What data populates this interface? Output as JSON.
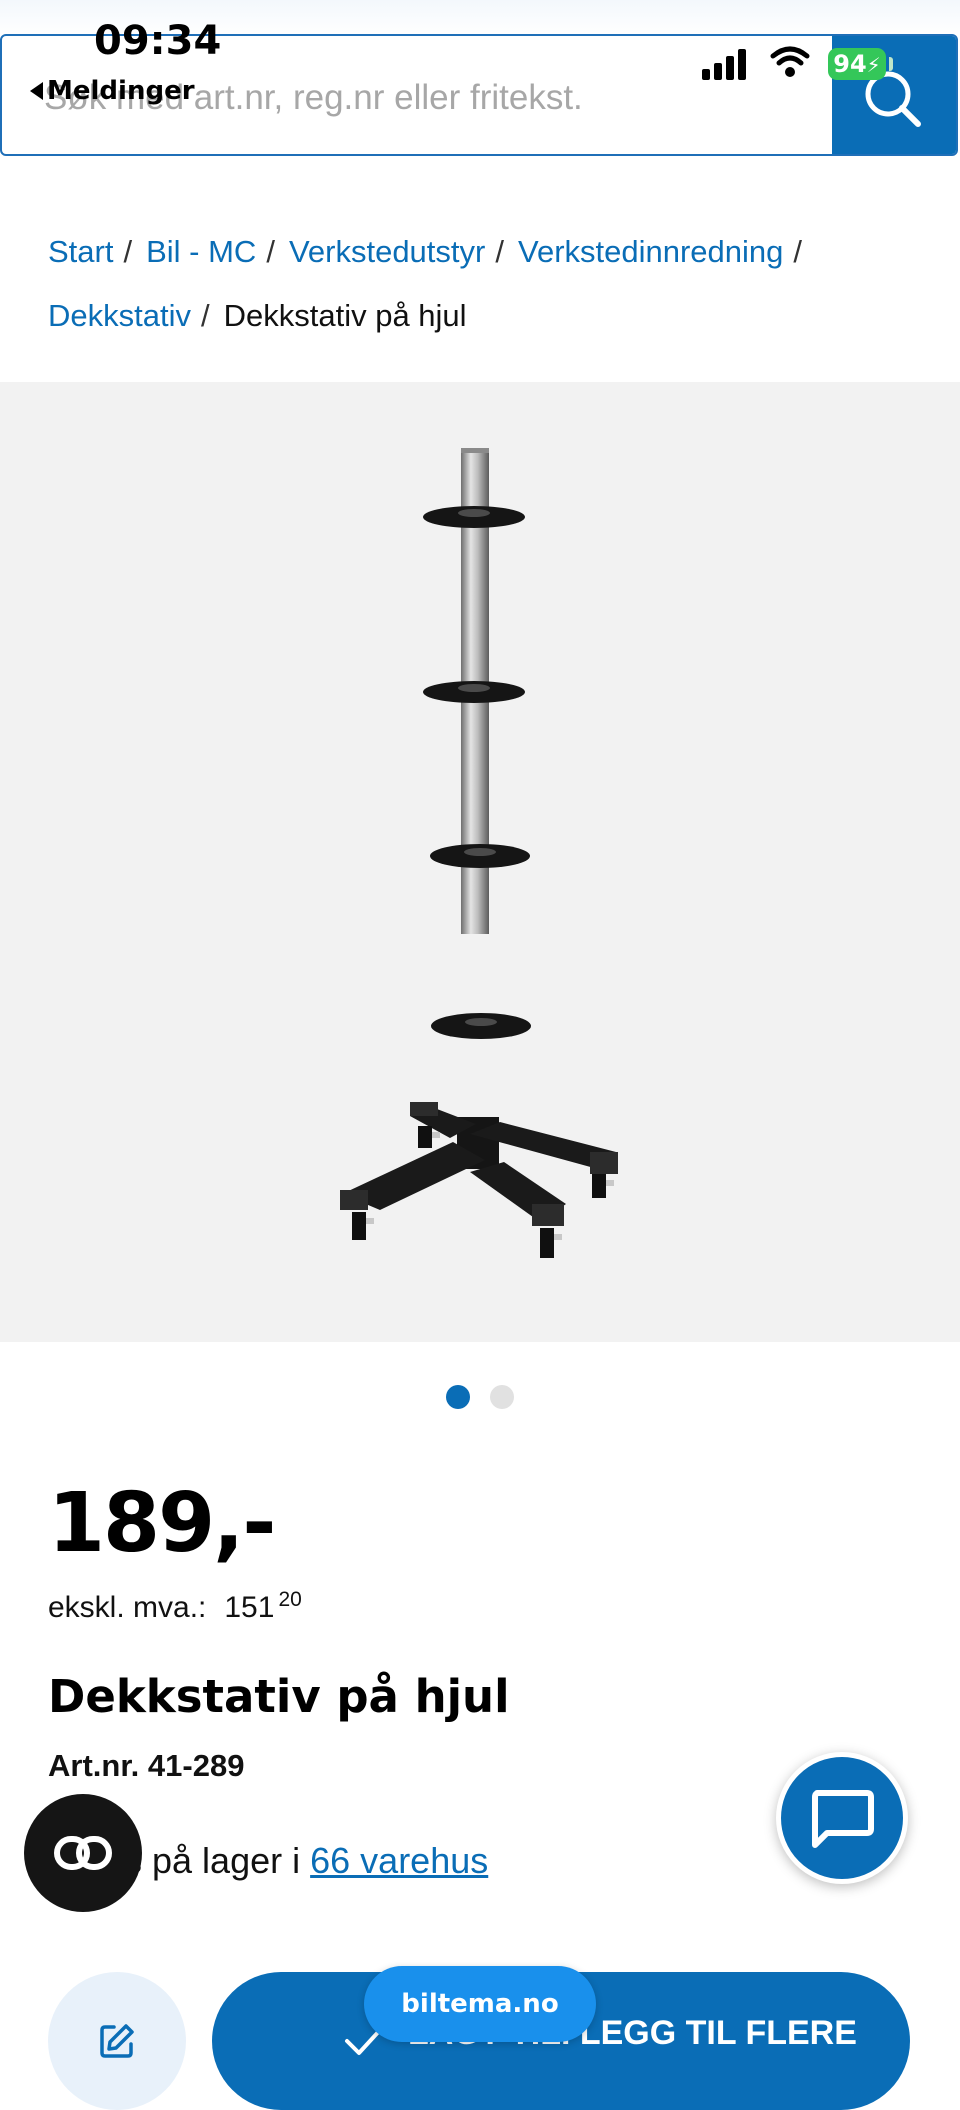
{
  "status_bar": {
    "time": "09:34",
    "back_label": "Meldinger",
    "battery": "94"
  },
  "search": {
    "placeholder": "Søk med art.nr, reg.nr eller fritekst."
  },
  "breadcrumb": {
    "items": [
      "Start",
      "Bil - MC",
      "Verkstedutstyr",
      "Verkstedinnredning",
      "Dekkstativ"
    ],
    "current": "Dekkstativ på hjul",
    "separator": "/"
  },
  "gallery": {
    "image_count": 2,
    "active_index": 0
  },
  "product": {
    "price": "189,-",
    "excl_vat_label": "ekskl. mva.:",
    "excl_vat_value": "151",
    "excl_vat_decimals": "20",
    "title": "Dekkstativ på hjul",
    "art_nr": "Art.nr. 41-289",
    "stock_prefix": "s på lager i",
    "stock_link": "66 varehus"
  },
  "actions": {
    "cart_label": "LAGT TIL. LEGG TIL FLERE"
  },
  "browser": {
    "domain": "biltema.no"
  },
  "colors": {
    "brand_blue": "#0a6db6",
    "battery_green": "#34c759",
    "pill_blue": "#1990ec"
  },
  "icons": {
    "search": "search-icon",
    "chat": "chat-bubble-icon",
    "edit": "edit-icon",
    "check": "check-icon",
    "link": "link-icon"
  }
}
